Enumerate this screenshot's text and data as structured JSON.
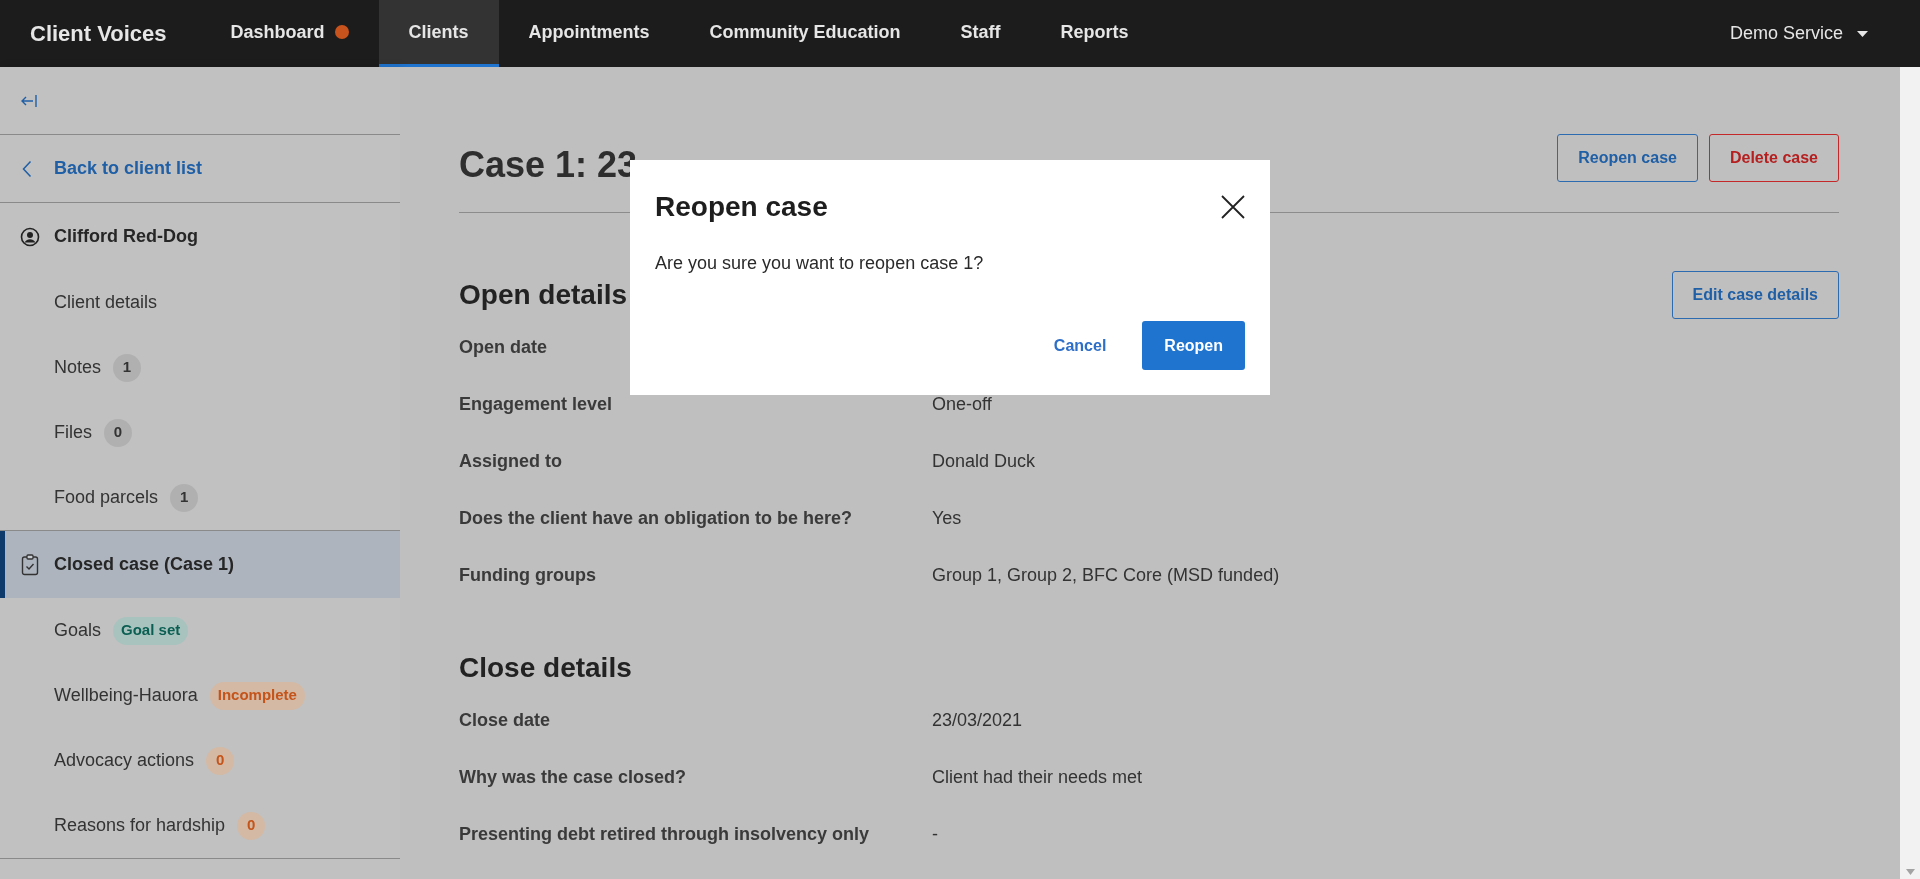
{
  "app": {
    "brand": "Client Voices",
    "account": "Demo Service"
  },
  "nav": [
    {
      "label": "Dashboard",
      "selected": false,
      "alert": true
    },
    {
      "label": "Clients",
      "selected": true,
      "alert": false
    },
    {
      "label": "Appointments",
      "selected": false,
      "alert": false
    },
    {
      "label": "Community Education",
      "selected": false,
      "alert": false
    },
    {
      "label": "Staff",
      "selected": false,
      "alert": false
    },
    {
      "label": "Reports",
      "selected": false,
      "alert": false
    }
  ],
  "sidebar": {
    "back": "Back to client list",
    "sections": [
      {
        "kind": "client",
        "title": "Clifford Red-Dog",
        "selected": false,
        "items": [
          {
            "label": "Client details"
          },
          {
            "label": "Notes",
            "badge": {
              "text": "1",
              "color": "#b0b0b0"
            }
          },
          {
            "label": "Files",
            "badge": {
              "text": "0",
              "color": "#b0b0b0"
            }
          },
          {
            "label": "Food parcels",
            "badge": {
              "text": "1",
              "color": "#b0b0b0"
            }
          }
        ]
      },
      {
        "kind": "case",
        "title": "Closed case (Case 1)",
        "selected": true,
        "items": [
          {
            "label": "Goals",
            "badge": {
              "text": "Goal set",
              "color": "#a8c3be"
            }
          },
          {
            "label": "Wellbeing-Hauora",
            "badge": {
              "text": "Incomplete",
              "color": "#d4b9a4"
            }
          },
          {
            "label": "Advocacy actions",
            "badge": {
              "text": "0",
              "color": "#d4b9a4"
            }
          },
          {
            "label": "Reasons for hardship",
            "badge": {
              "text": "0",
              "color": "#d4b9a4"
            }
          }
        ]
      }
    ]
  },
  "case": {
    "title": "Case 1: 23",
    "actions": [
      {
        "label": "Reopen case",
        "kind": "primary"
      },
      {
        "label": "Delete case",
        "kind": "danger"
      }
    ],
    "sections": [
      {
        "heading": "Open details",
        "action": "Edit case details",
        "rows": [
          {
            "label": "Open date"
          },
          {
            "label": "Engagement level",
            "value": "One-off"
          },
          {
            "label": "Assigned to",
            "value": "Donald Duck"
          },
          {
            "label": "Does the client have an obligation to be here?",
            "value": "Yes"
          },
          {
            "label": "Funding groups",
            "value": "Group 1, Group 2, BFC Core (MSD funded)"
          }
        ]
      },
      {
        "heading": "Close details",
        "rows": [
          {
            "label": "Close date",
            "value": "23/03/2021"
          },
          {
            "label": "Why was the case closed?",
            "value": "Client had their needs met"
          },
          {
            "label": "Presenting debt retired through insolvency only",
            "value": "-"
          }
        ]
      }
    ]
  },
  "dialog": {
    "title": "Reopen case",
    "message": "Are you sure you want to reopen case 1?",
    "cancel": "Cancel",
    "confirm": "Reopen"
  }
}
